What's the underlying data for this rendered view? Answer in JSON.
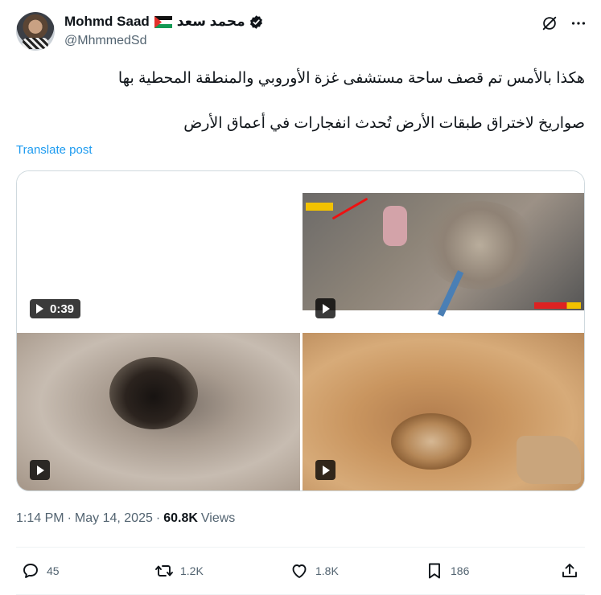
{
  "author": {
    "name": "Mohmd Saad",
    "name_arabic": "محمد سعد",
    "handle": "@MhmmedSd",
    "flag_icon": "palestine-flag-icon",
    "verified_icon": "verified-badge-icon"
  },
  "header_icons": [
    "grok-icon",
    "more-icon"
  ],
  "tweet": {
    "text": "هكذا بالأمس تم قصف ساحة مستشفى غزة الأوروبي والمنطقة المحطية بها\n\nصواريخ لاختراق طبقات الأرض تُحدث انفجارات في أعماق الأرض",
    "translate_label": "Translate post"
  },
  "media": {
    "items": [
      {
        "type": "video",
        "duration": "0:39"
      },
      {
        "type": "video"
      },
      {
        "type": "video"
      },
      {
        "type": "video"
      }
    ]
  },
  "meta": {
    "time": "1:14 PM",
    "separator": "·",
    "date": "May 14, 2025",
    "views_count": "60.8K",
    "views_label": "Views"
  },
  "actions": {
    "replies": "45",
    "reposts": "1.2K",
    "likes": "1.8K",
    "bookmarks": "186"
  },
  "colors": {
    "text": "#0f1419",
    "secondary": "#536471",
    "link": "#1d9bf0",
    "border": "#cfd9de"
  }
}
